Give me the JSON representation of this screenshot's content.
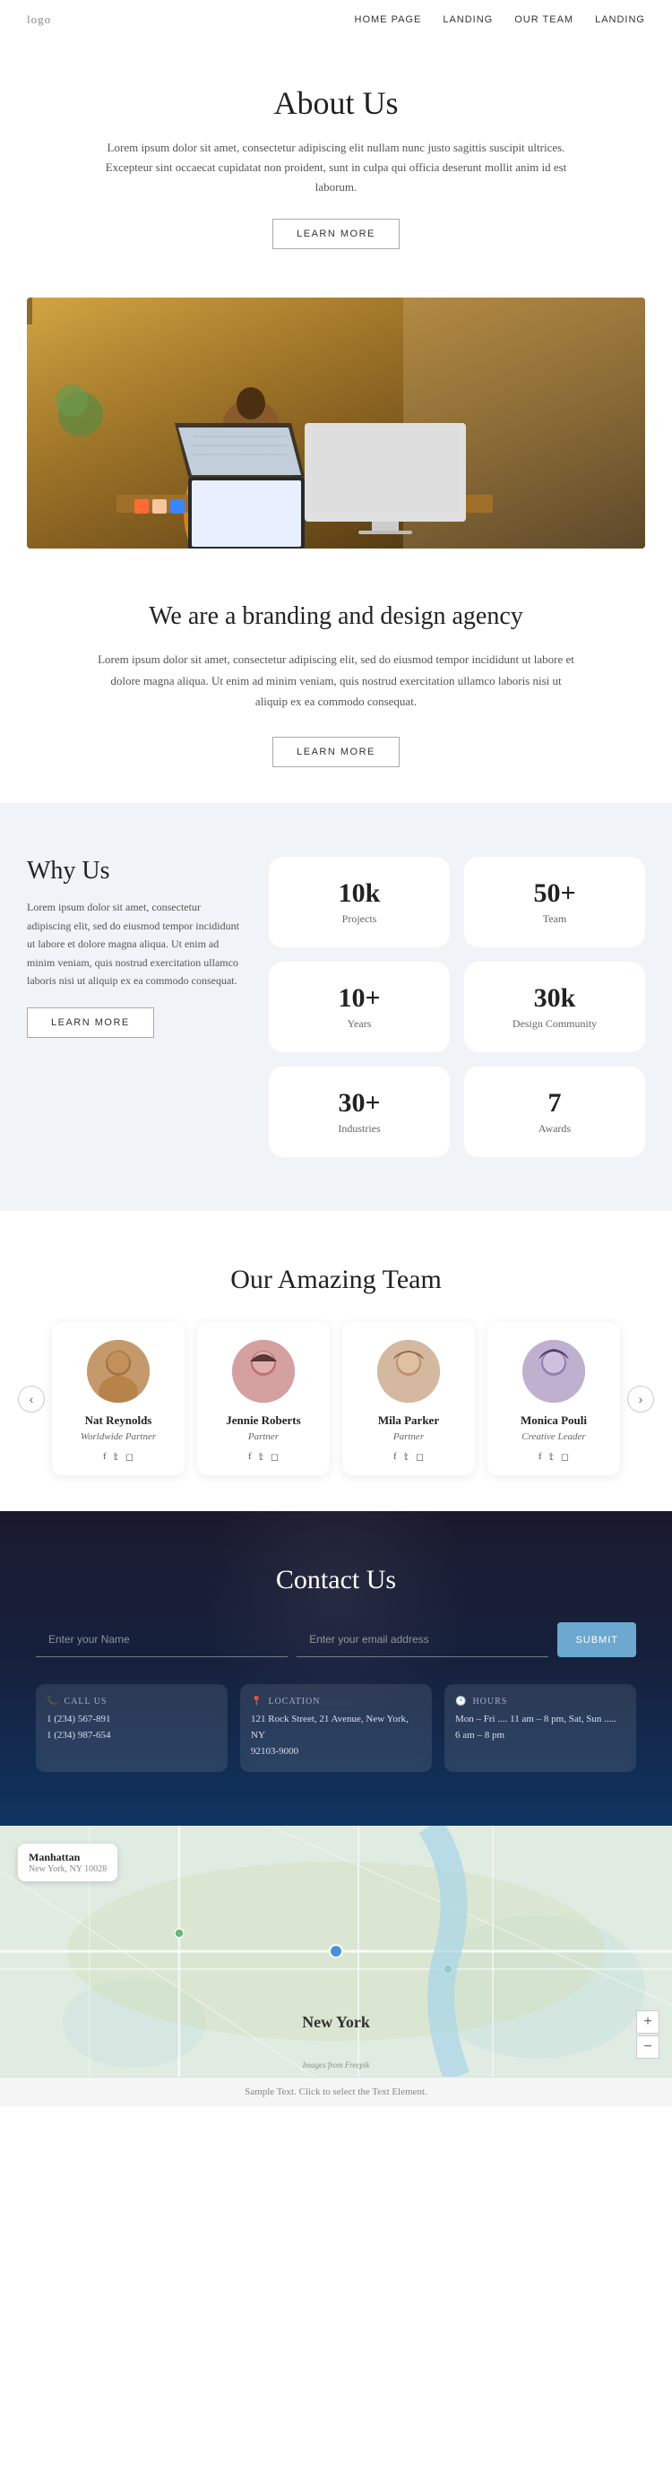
{
  "nav": {
    "logo": "logo",
    "links": [
      "HOME PAGE",
      "LANDING",
      "OUR TEAM",
      "LANDING"
    ]
  },
  "about": {
    "title": "About Us",
    "description": "Lorem ipsum dolor sit amet, consectetur adipiscing elit nullam nunc justo sagittis suscipit ultrices. Excepteur sint occaecat cupidatat non proident, sunt in culpa qui officia deserunt mollit anim id est laborum.",
    "btn_label": "LEARN MORE"
  },
  "branding": {
    "title": "We are a branding and design agency",
    "description": "Lorem ipsum dolor sit amet, consectetur adipiscing elit, sed do eiusmod tempor incididunt ut labore et dolore magna aliqua. Ut enim ad minim veniam, quis nostrud exercitation ullamco laboris nisi ut aliquip ex ea commodo consequat.",
    "btn_label": "LEARN MORE"
  },
  "why_us": {
    "title": "Why Us",
    "description": "Lorem ipsum dolor sit amet, consectetur adipiscing elit, sed do eiusmod tempor incididunt ut labore et dolore magna aliqua. Ut enim ad minim veniam, quis nostrud exercitation ullamco laboris nisi ut aliquip ex ea commodo consequat.",
    "btn_label": "LEARN MORE",
    "stats": [
      {
        "number": "10k",
        "label": "Projects"
      },
      {
        "number": "50+",
        "label": "Team"
      },
      {
        "number": "10+",
        "label": "Years"
      },
      {
        "number": "30k",
        "label": "Design Community"
      },
      {
        "number": "30+",
        "label": "Industries"
      },
      {
        "number": "7",
        "label": "Awards"
      }
    ]
  },
  "team": {
    "title": "Our Amazing Team",
    "members": [
      {
        "name": "Nat Reynolds",
        "role": "Worldwide Partner"
      },
      {
        "name": "Jennie Roberts",
        "role": "Partner"
      },
      {
        "name": "Mila Parker",
        "role": "Partner"
      },
      {
        "name": "Monica Pouli",
        "role": "Creative Leader"
      }
    ],
    "prev_btn": "‹",
    "next_btn": "›"
  },
  "contact": {
    "title": "Contact Us",
    "form": {
      "name_placeholder": "Enter your Name",
      "email_placeholder": "Enter your email address",
      "submit_label": "SUBMIT"
    },
    "call_title": "CALL US",
    "call_lines": [
      "1 (234) 567-891",
      "1 (234) 987-654"
    ],
    "location_title": "LOCATION",
    "location_lines": [
      "121 Rock Street, 21 Avenue, New York, NY",
      "92103-9000"
    ],
    "hours_title": "HOURS",
    "hours_lines": [
      "Mon – Fri .... 11 am – 8 pm, Sat, Sun .....",
      "6 am – 8 pm"
    ]
  },
  "map": {
    "city": "Manhattan",
    "state": "New York, NY 10028",
    "label": "New York",
    "zoom_in": "+",
    "zoom_out": "−"
  },
  "footer": {
    "text": "Sample Text. Click to select the Text Element."
  }
}
